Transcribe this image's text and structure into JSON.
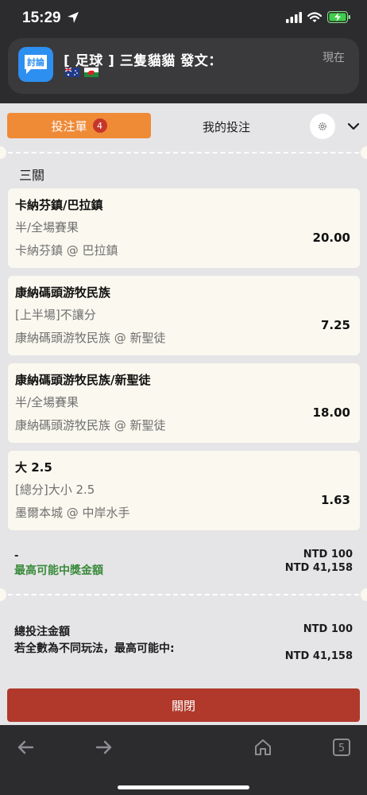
{
  "status_bar": {
    "time": "15:29"
  },
  "notification": {
    "app_icon_text": "討論",
    "title": "[ 足球 ] 三隻貓貓 發文：",
    "time": "現在",
    "flags": [
      "australia-flag-icon",
      "wales-flag-icon"
    ]
  },
  "tabs": {
    "bet_slip": "投注單",
    "bet_slip_count": "4",
    "my_bets": "我的投注"
  },
  "section_title": "三關",
  "bets": [
    {
      "selection": "卡納芬鎮/巴拉鎮",
      "market": "半/全場賽果",
      "match": "卡納芬鎮 @ 巴拉鎮",
      "odds": "20.00"
    },
    {
      "selection": "康納碼頭游牧民族",
      "market": "[上半場]不讓分",
      "match": "康納碼頭游牧民族 @ 新聖徒",
      "odds": "7.25"
    },
    {
      "selection": "康納碼頭游牧民族/新聖徒",
      "market": "半/全場賽果",
      "match": "康納碼頭游牧民族 @ 新聖徒",
      "odds": "18.00"
    },
    {
      "selection": "大 2.5",
      "market": "[總分]大小 2.5",
      "match": "墨爾本城 @ 中岸水手",
      "odds": "1.63"
    }
  ],
  "summary": {
    "dash": "-",
    "stake": "NTD 100",
    "max_win_label": "最高可能中獎金額",
    "max_win": "NTD 41,158"
  },
  "totals": {
    "total_label": "總投注金額",
    "total_value": "NTD 100",
    "diff_label": "若全數為不同玩法，最高可能中:",
    "diff_value": "NTD 41,158"
  },
  "close_label": "關閉",
  "toolbar": {
    "tabs_count": "5"
  },
  "colors": {
    "accent": "#ef8a37",
    "badge": "#c6352a",
    "close": "#b0392b",
    "win_green": "#3a8a3a"
  }
}
